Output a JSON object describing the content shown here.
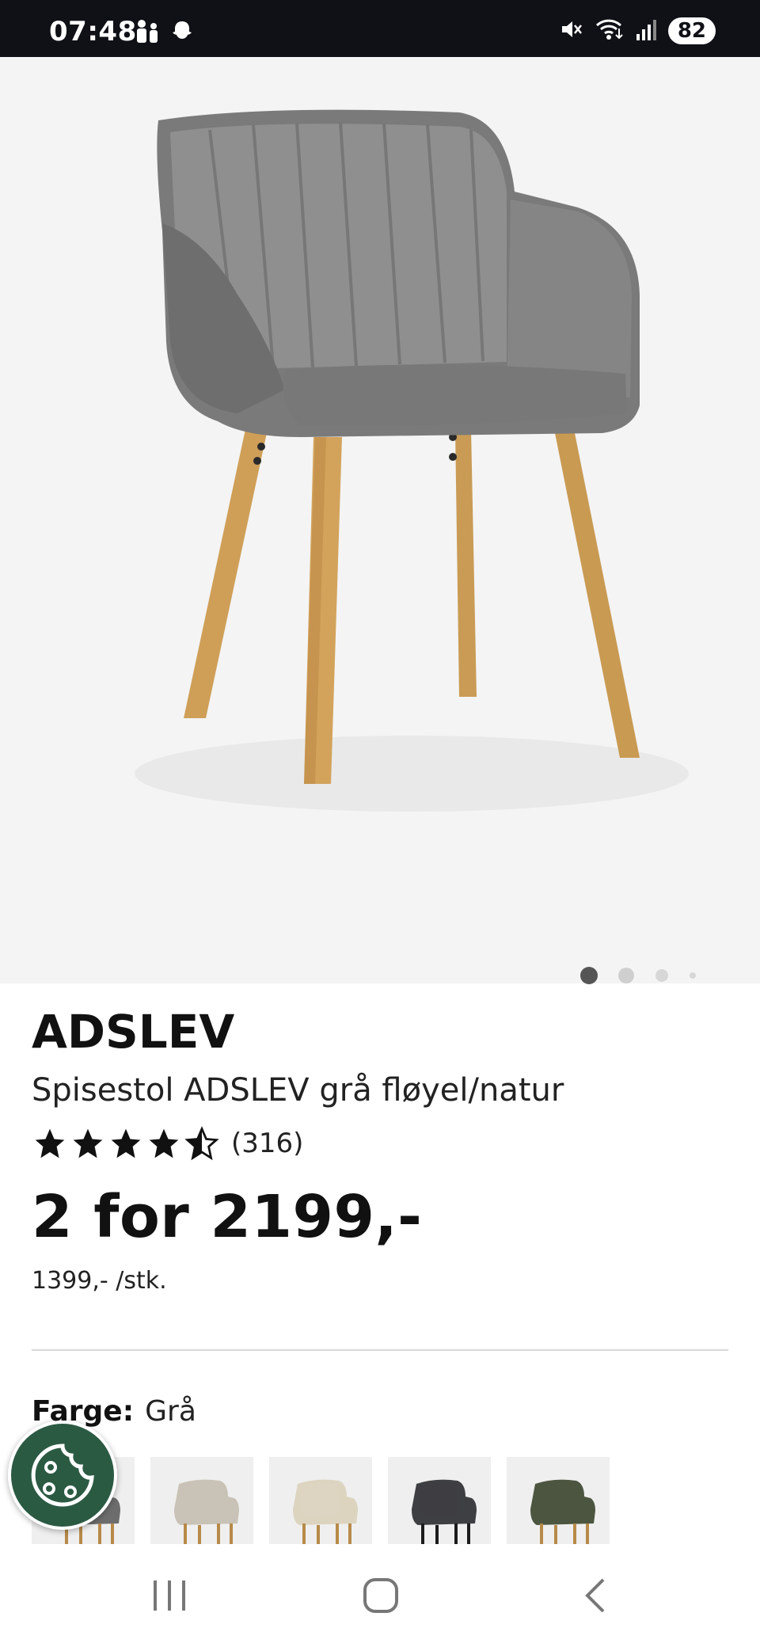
{
  "status_bar": {
    "time": "07:48",
    "battery": "82",
    "icons_left": [
      "family-icon",
      "snapchat-icon"
    ],
    "icons_right": [
      "mute-icon",
      "wifi-icon",
      "signal-icon",
      "battery-icon"
    ]
  },
  "gallery": {
    "active_index": 0,
    "dot_count": 4
  },
  "product": {
    "brand": "ADSLEV",
    "name": "Spisestol ADSLEV grå fløyel/natur",
    "rating_stars": 4.5,
    "review_count": "(316)",
    "price": "2 for 2199,-",
    "unit_price": "1399,- /stk."
  },
  "color_selector": {
    "label": "Farge:",
    "value": "Grå",
    "swatches": [
      {
        "name": "Grå",
        "color": "#6d6d6d",
        "legs": "#b78a4a"
      },
      {
        "name": "Beige",
        "color": "#c9c2b6",
        "legs": "#b78a4a"
      },
      {
        "name": "Krem",
        "color": "#ddd4c0",
        "legs": "#b78a4a"
      },
      {
        "name": "Mørk grå",
        "color": "#3e3f42",
        "legs": "#1c1c1c"
      },
      {
        "name": "Grønn",
        "color": "#4c5540",
        "legs": "#b78a4a"
      }
    ]
  },
  "colors": {
    "status_bg": "#0f1117",
    "hero_bg": "#f4f4f4",
    "cookie_button": "#2b5a43"
  },
  "nav": {
    "buttons": [
      "recent-apps",
      "home",
      "back"
    ]
  }
}
